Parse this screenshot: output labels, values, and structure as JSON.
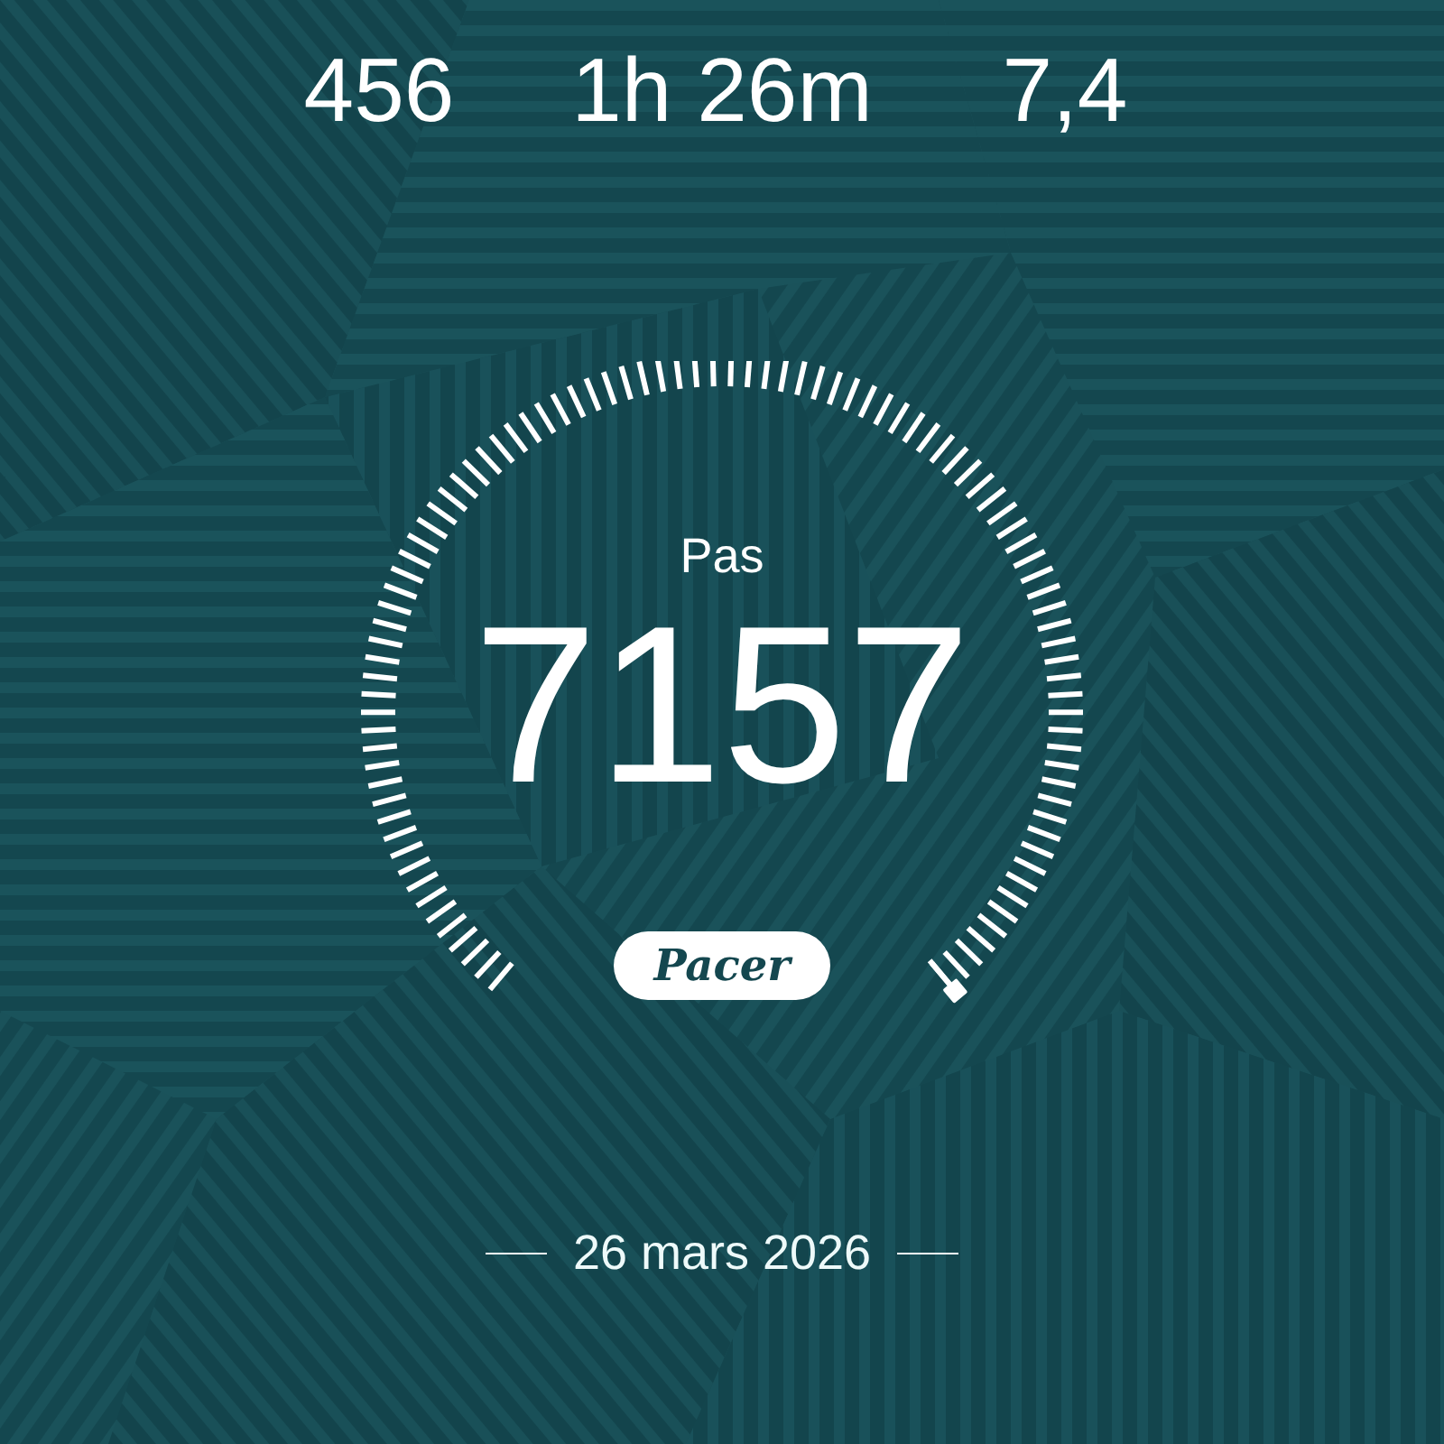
{
  "stats": [
    {
      "value": "456"
    },
    {
      "value": "1h 26m"
    },
    {
      "value": "7,4"
    }
  ],
  "steps": {
    "label": "Pas",
    "value": "7157"
  },
  "brand": "Pacer",
  "date": "26 mars 2026"
}
